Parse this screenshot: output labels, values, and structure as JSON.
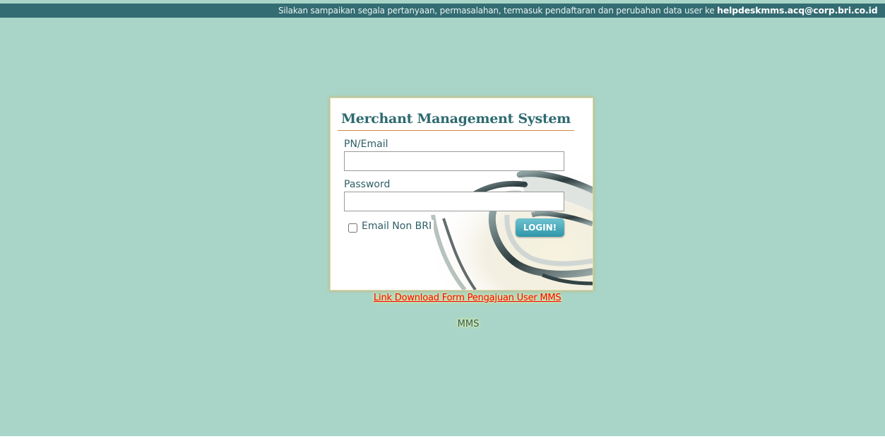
{
  "header": {
    "notice_text": "Silakan sampaikan segala pertanyaan, permasalahan, termasuk pendaftaran dan perubahan data user ke",
    "helpdesk_email": "helpdeskmms.acq@corp.bri.co.id"
  },
  "login_form": {
    "title": "Merchant Management System",
    "username_label": "PN/Email",
    "username_value": "",
    "password_label": "Password",
    "password_value": "",
    "checkbox_label": "Email Non BRI",
    "checkbox_checked": false,
    "submit_label": "LOGIN!"
  },
  "links": {
    "download_form": "Link Download Form Pengajuan User MMS"
  },
  "footer": {
    "text": "MMS"
  },
  "colors": {
    "page_background": "#a8d5c8",
    "header_background": "#336c72",
    "title_color": "#2e6a70",
    "title_underline": "#d58a46",
    "login_button": "#2f96a9",
    "link_color": "#ff0000"
  },
  "icons": {
    "card_background_graphic": "curved-3d-shape-graphic"
  }
}
